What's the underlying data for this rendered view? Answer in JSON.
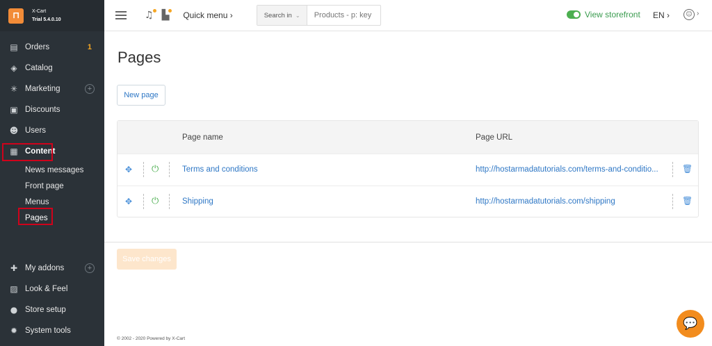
{
  "brand": {
    "name": "X-Cart",
    "version": "Trial 5.4.0.10"
  },
  "sidebar": {
    "items": [
      {
        "label": "Orders",
        "icon": "orders-icon",
        "badge": "1"
      },
      {
        "label": "Catalog",
        "icon": "tag-icon"
      },
      {
        "label": "Marketing",
        "icon": "marketing-icon"
      },
      {
        "label": "Discounts",
        "icon": "gift-icon"
      },
      {
        "label": "Users",
        "icon": "users-icon"
      },
      {
        "label": "Content",
        "icon": "content-icon"
      }
    ],
    "content_sub": [
      {
        "label": "News messages"
      },
      {
        "label": "Front page"
      },
      {
        "label": "Menus"
      },
      {
        "label": "Pages"
      }
    ],
    "bottom_items": [
      {
        "label": "My addons",
        "icon": "puzzle-icon"
      },
      {
        "label": "Look & Feel",
        "icon": "image-icon"
      },
      {
        "label": "Store setup",
        "icon": "store-icon"
      },
      {
        "label": "System tools",
        "icon": "gear-icon"
      }
    ]
  },
  "header": {
    "quick_menu": "Quick menu ›",
    "search_in": "Search in",
    "search_placeholder": "Products - p: key",
    "view_storefront": "View storefront",
    "language": "EN ›"
  },
  "main": {
    "title": "Pages",
    "new_page_button": "New page",
    "columns": {
      "name": "Page name",
      "url": "Page URL"
    },
    "rows": [
      {
        "name": "Terms and conditions",
        "url": "http://hostarmadatutorials.com/terms-and-conditio..."
      },
      {
        "name": "Shipping",
        "url": "http://hostarmadatutorials.com/shipping"
      }
    ],
    "save_button": "Save changes"
  },
  "footer": {
    "text": "© 2002 - 2020 Powered by X-Cart"
  },
  "colors": {
    "accent": "#f28c38",
    "link": "#2e77c5",
    "sidebar_bg": "#2b3238",
    "highlight": "#d0021b"
  }
}
